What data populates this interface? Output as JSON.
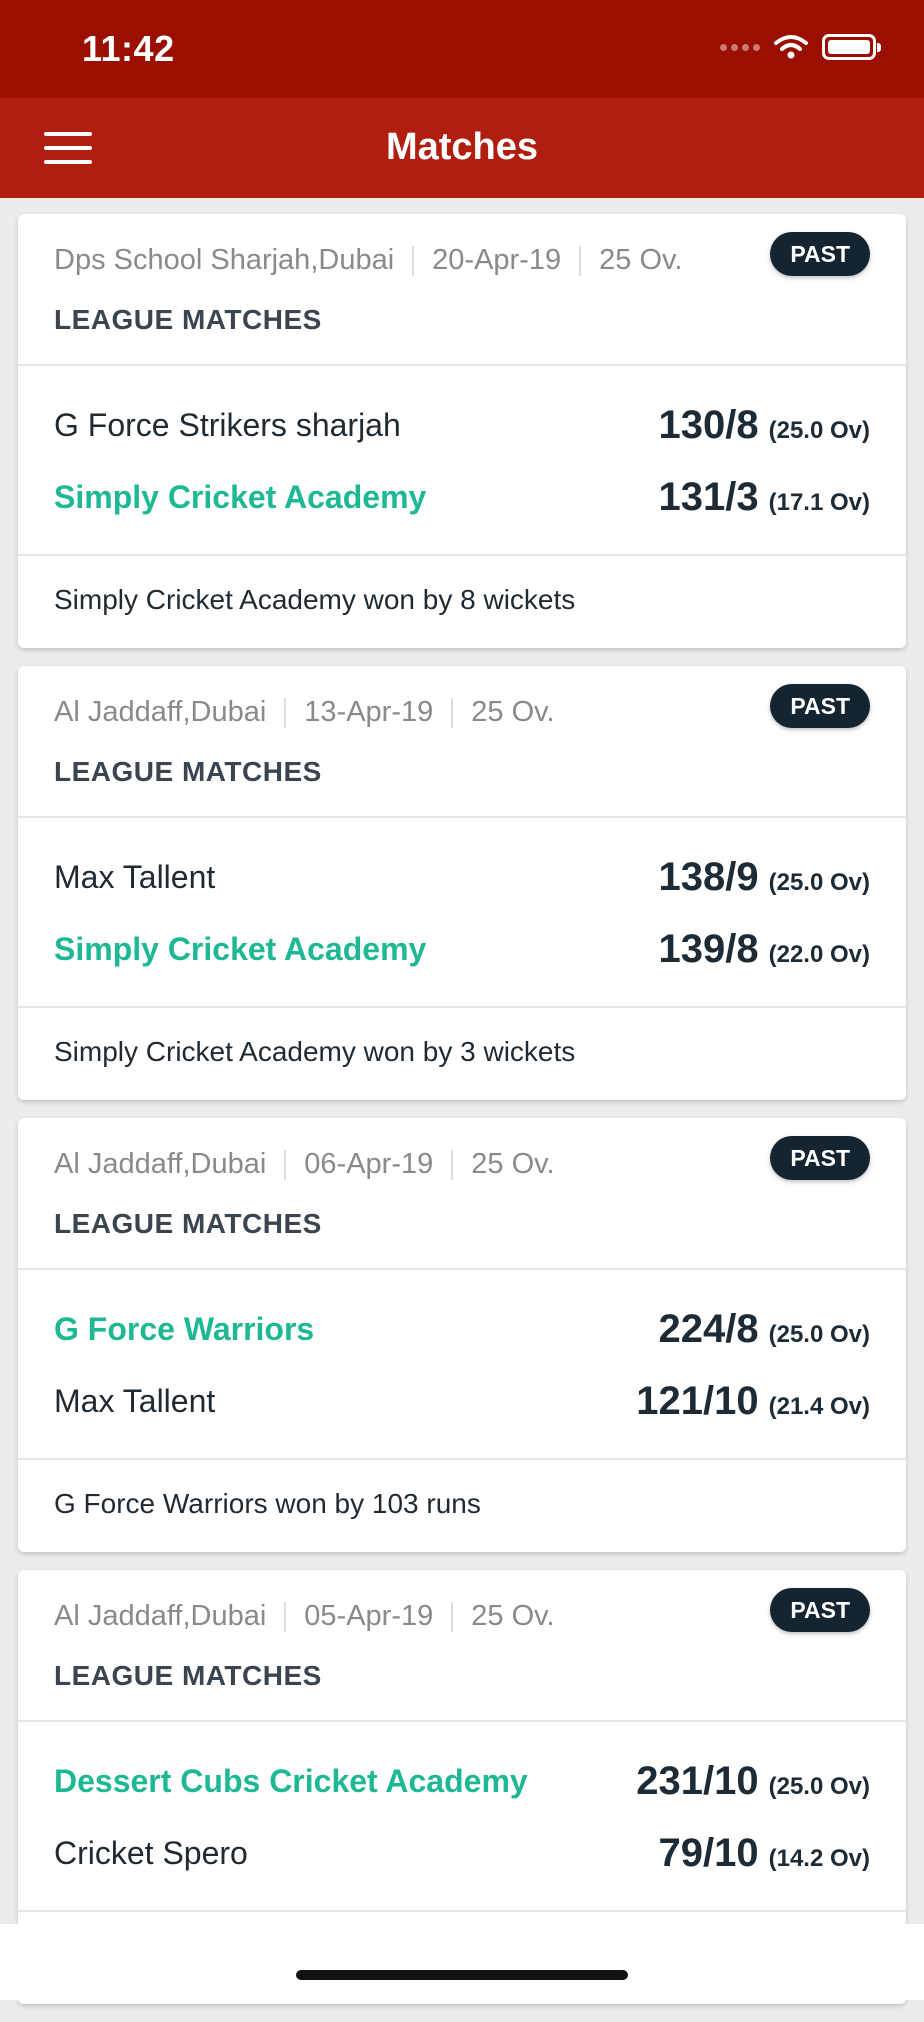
{
  "status": {
    "time": "11:42"
  },
  "header": {
    "title": "Matches"
  },
  "matches": [
    {
      "venue": "Dps School Sharjah,Dubai",
      "date": "20-Apr-19",
      "overs_limit": "25 Ov.",
      "badge": "PAST",
      "category": "LEAGUE MATCHES",
      "team1": {
        "name": "G Force Strikers sharjah",
        "score": "130/8",
        "overs": "(25.0 Ov)",
        "winner": false
      },
      "team2": {
        "name": "Simply Cricket Academy",
        "score": "131/3",
        "overs": "(17.1 Ov)",
        "winner": true
      },
      "result": "Simply Cricket Academy won by 8 wickets"
    },
    {
      "venue": "Al Jaddaff,Dubai",
      "date": "13-Apr-19",
      "overs_limit": "25 Ov.",
      "badge": "PAST",
      "category": "LEAGUE MATCHES",
      "team1": {
        "name": "Max Tallent",
        "score": "138/9",
        "overs": "(25.0 Ov)",
        "winner": false
      },
      "team2": {
        "name": "Simply Cricket Academy",
        "score": "139/8",
        "overs": "(22.0 Ov)",
        "winner": true
      },
      "result": "Simply Cricket Academy won by 3 wickets"
    },
    {
      "venue": "Al Jaddaff,Dubai",
      "date": "06-Apr-19",
      "overs_limit": "25 Ov.",
      "badge": "PAST",
      "category": "LEAGUE MATCHES",
      "team1": {
        "name": "G Force Warriors",
        "score": "224/8",
        "overs": "(25.0 Ov)",
        "winner": true
      },
      "team2": {
        "name": "Max Tallent",
        "score": "121/10",
        "overs": "(21.4 Ov)",
        "winner": false
      },
      "result": "G Force Warriors won by 103 runs"
    },
    {
      "venue": "Al Jaddaff,Dubai",
      "date": "05-Apr-19",
      "overs_limit": "25 Ov.",
      "badge": "PAST",
      "category": "LEAGUE MATCHES",
      "team1": {
        "name": "Dessert Cubs Cricket Academy",
        "score": "231/10",
        "overs": "(25.0 Ov)",
        "winner": true
      },
      "team2": {
        "name": "Cricket Spero",
        "score": "79/10",
        "overs": "(14.2 Ov)",
        "winner": false
      },
      "result": ""
    }
  ]
}
